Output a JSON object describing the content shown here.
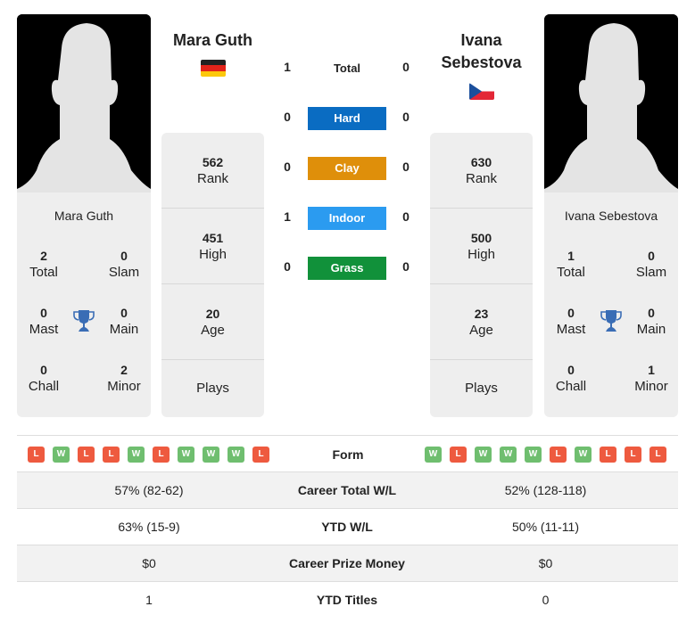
{
  "player1": {
    "name": "Mara Guth",
    "header_name_lines": [
      "Mara Guth"
    ],
    "country_flag": "germany-flag",
    "titles": {
      "total": {
        "value": "2",
        "label": "Total"
      },
      "slam": {
        "value": "0",
        "label": "Slam"
      },
      "mast": {
        "value": "0",
        "label": "Mast"
      },
      "main": {
        "value": "0",
        "label": "Main"
      },
      "chall": {
        "value": "0",
        "label": "Chall"
      },
      "minor": {
        "value": "2",
        "label": "Minor"
      }
    },
    "stats": {
      "rank": {
        "value": "562",
        "label": "Rank"
      },
      "high": {
        "value": "451",
        "label": "High"
      },
      "age": {
        "value": "20",
        "label": "Age"
      },
      "plays": {
        "value": "",
        "label": "Plays"
      }
    },
    "form": [
      "L",
      "W",
      "L",
      "L",
      "W",
      "L",
      "W",
      "W",
      "W",
      "L"
    ]
  },
  "player2": {
    "name": "Ivana Sebestova",
    "header_name_lines": [
      "Ivana",
      "Sebestova"
    ],
    "country_flag": "czech-flag",
    "titles": {
      "total": {
        "value": "1",
        "label": "Total"
      },
      "slam": {
        "value": "0",
        "label": "Slam"
      },
      "mast": {
        "value": "0",
        "label": "Mast"
      },
      "main": {
        "value": "0",
        "label": "Main"
      },
      "chall": {
        "value": "0",
        "label": "Chall"
      },
      "minor": {
        "value": "1",
        "label": "Minor"
      }
    },
    "stats": {
      "rank": {
        "value": "630",
        "label": "Rank"
      },
      "high": {
        "value": "500",
        "label": "High"
      },
      "age": {
        "value": "23",
        "label": "Age"
      },
      "plays": {
        "value": "",
        "label": "Plays"
      }
    },
    "form": [
      "W",
      "L",
      "W",
      "W",
      "W",
      "L",
      "W",
      "L",
      "L",
      "L"
    ]
  },
  "h2h": {
    "total": {
      "label": "Total",
      "p1": "1",
      "p2": "0"
    },
    "surfaces": [
      {
        "label": "Hard",
        "p1": "0",
        "p2": "0",
        "color": "#0a6cc2"
      },
      {
        "label": "Clay",
        "p1": "0",
        "p2": "0",
        "color": "#df8f0a"
      },
      {
        "label": "Indoor",
        "p1": "1",
        "p2": "0",
        "color": "#2b9bf0"
      },
      {
        "label": "Grass",
        "p1": "0",
        "p2": "0",
        "color": "#11913a"
      }
    ]
  },
  "comparison": {
    "form_label": "Form",
    "rows": [
      {
        "label": "Career Total W/L",
        "p1": "57% (82-62)",
        "p2": "52% (128-118)"
      },
      {
        "label": "YTD W/L",
        "p1": "63% (15-9)",
        "p2": "50% (11-11)"
      },
      {
        "label": "Career Prize Money",
        "p1": "$0",
        "p2": "$0"
      },
      {
        "label": "YTD Titles",
        "p1": "1",
        "p2": "0"
      }
    ]
  },
  "colors": {
    "win": "#6fbe6f",
    "loss": "#ee5a3f",
    "trophy": "#3a6db5",
    "card_bg": "#eeeeee"
  }
}
